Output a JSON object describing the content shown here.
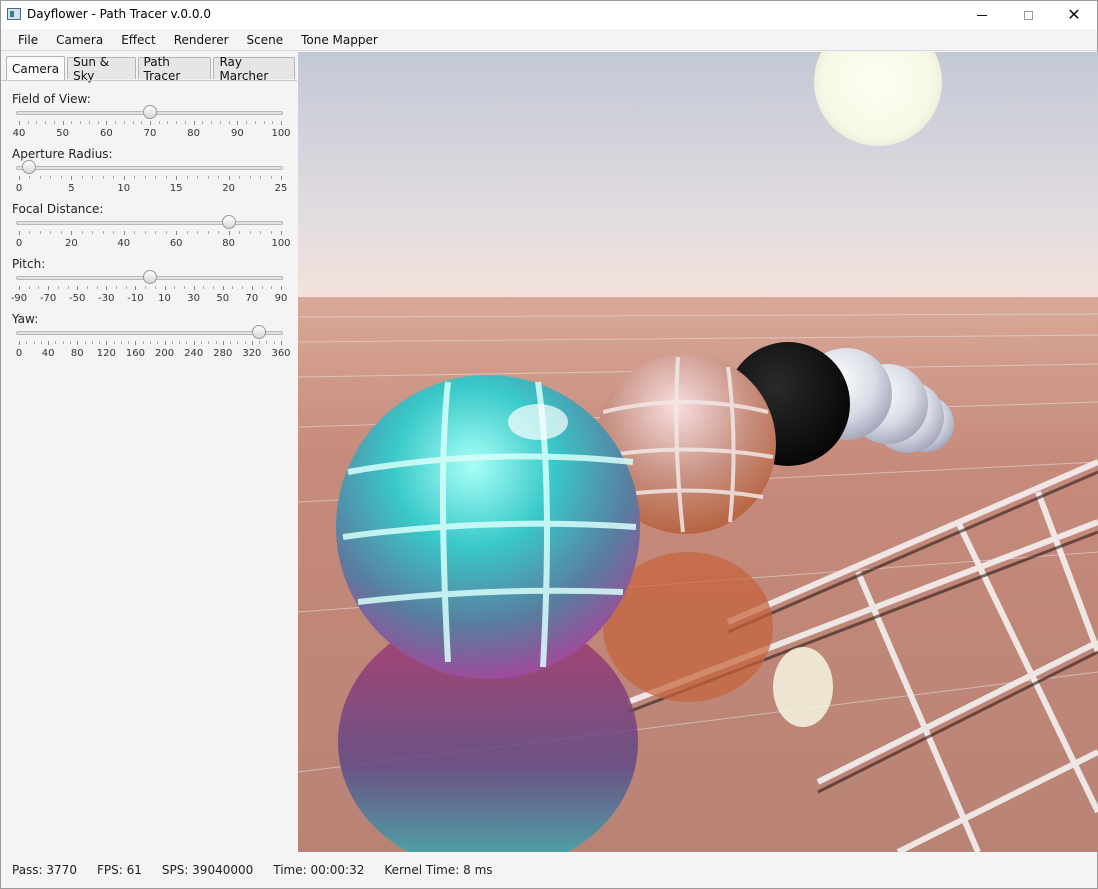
{
  "window": {
    "title": "Dayflower - Path Tracer v.0.0.0",
    "controls": {
      "minimize": "—",
      "maximize": "☐",
      "close": "✕"
    }
  },
  "menu": [
    "File",
    "Camera",
    "Effect",
    "Renderer",
    "Scene",
    "Tone Mapper"
  ],
  "tabs": [
    {
      "label": "Camera",
      "active": true
    },
    {
      "label": "Sun & Sky",
      "active": false
    },
    {
      "label": "Path Tracer",
      "active": false
    },
    {
      "label": "Ray Marcher",
      "active": false
    }
  ],
  "sliders": [
    {
      "label": "Field of View:",
      "min": 40,
      "max": 100,
      "value": 70,
      "ticks": [
        "40",
        "50",
        "60",
        "70",
        "80",
        "90",
        "100"
      ],
      "minor": 5
    },
    {
      "label": "Aperture Radius:",
      "min": 0,
      "max": 25,
      "value": 1,
      "ticks": [
        "0",
        "5",
        "10",
        "15",
        "20",
        "25"
      ],
      "minor": 5
    },
    {
      "label": "Focal Distance:",
      "min": 0,
      "max": 100,
      "value": 80,
      "ticks": [
        "0",
        "20",
        "40",
        "60",
        "80",
        "100"
      ],
      "minor": 5
    },
    {
      "label": "Pitch:",
      "min": -90,
      "max": 90,
      "value": 0,
      "ticks": [
        "-90",
        "-70",
        "-50",
        "-30",
        "-10",
        "10",
        "30",
        "50",
        "70",
        "90"
      ],
      "minor": 3
    },
    {
      "label": "Yaw:",
      "min": 0,
      "max": 360,
      "value": 330,
      "ticks": [
        "0",
        "40",
        "80",
        "120",
        "160",
        "200",
        "240",
        "280",
        "320",
        "360"
      ],
      "minor": 4
    }
  ],
  "status": {
    "pass": "Pass: 3770",
    "fps": "FPS: 61",
    "sps": "SPS: 39040000",
    "time": "Time: 00:00:32",
    "kernel": "Kernel Time: 8 ms"
  },
  "scene": {
    "sky_top": "#c5cad8",
    "sky_bottom": "#f2e3dc",
    "floor": "#c98f7f",
    "spheres": [
      "cyan-chrome",
      "copper-chrome",
      "black",
      "silver",
      "silver",
      "silver",
      "silver"
    ]
  }
}
